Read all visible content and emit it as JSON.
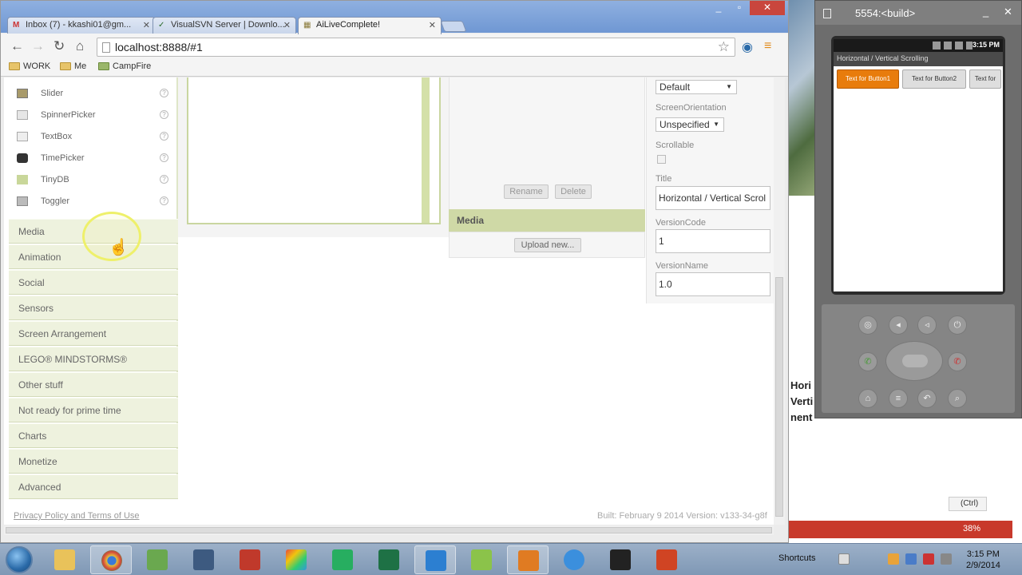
{
  "browser": {
    "tabs": [
      {
        "label": "Inbox (7) - kkashi01@gm..."
      },
      {
        "label": "VisualSVN Server | Downlo..."
      },
      {
        "label": "AiLiveComplete!"
      }
    ],
    "url": "localhost:8888/#1",
    "bookmarks": [
      "WORK",
      "Me",
      "CampFire"
    ]
  },
  "palette": {
    "items": [
      "Slider",
      "SpinnerPicker",
      "TextBox",
      "TimePicker",
      "TinyDB",
      "Toggler"
    ],
    "help_glyph": "?",
    "drawers": [
      "Media",
      "Animation",
      "Social",
      "Sensors",
      "Screen Arrangement",
      "LEGO® MINDSTORMS®",
      "Other stuff",
      "Not ready for prime time",
      "Charts",
      "Monetize",
      "Advanced"
    ]
  },
  "components": {
    "rename_label": "Rename",
    "delete_label": "Delete",
    "media_title": "Media",
    "upload_label": "Upload new..."
  },
  "properties": {
    "theme_value": "Default",
    "orientation_label": "ScreenOrientation",
    "orientation_value": "Unspecified",
    "scrollable_label": "Scrollable",
    "title_label": "Title",
    "title_value": "Horizontal / Vertical Scrol",
    "version_code_label": "VersionCode",
    "version_code_value": "1",
    "version_name_label": "VersionName",
    "version_name_value": "1.0"
  },
  "footer": {
    "privacy": "Privacy Policy and Terms of Use",
    "build": "Built: February 9 2014 Version: v133-34-g8f"
  },
  "emulator": {
    "title": "5554:<build>",
    "time": "3:15 PM",
    "app_title": "Horizontal / Vertical Scrolling",
    "buttons": [
      "Text for Button1",
      "Text for Button2",
      "Text for"
    ]
  },
  "background_doc": {
    "snippets": [
      "Hori",
      "Verti",
      "nent"
    ],
    "paste_label": "(Ctrl)",
    "zoom": "38%"
  },
  "taskbar": {
    "shortcuts_label": "Shortcuts",
    "time": "3:15 PM",
    "date": "2/9/2014"
  },
  "colors": {
    "drawer_bg": "#eef2de",
    "media_header": "#cfd9a6",
    "emulator_orange": "#e87c0c"
  }
}
